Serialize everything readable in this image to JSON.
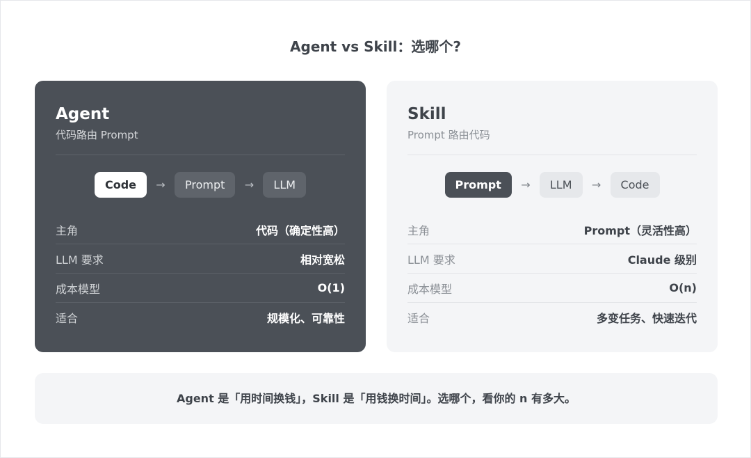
{
  "title": "Agent vs Skill：选哪个?",
  "cards": [
    {
      "title": "Agent",
      "subtitle": "代码路由 Prompt",
      "flow": [
        "Code",
        "Prompt",
        "LLM"
      ],
      "arrow": "→",
      "rows": [
        {
          "label": "主角",
          "value": "代码（确定性高）"
        },
        {
          "label": "LLM 要求",
          "value": "相对宽松"
        },
        {
          "label": "成本模型",
          "value": "O(1)"
        },
        {
          "label": "适合",
          "value": "规模化、可靠性"
        }
      ]
    },
    {
      "title": "Skill",
      "subtitle": "Prompt 路由代码",
      "flow": [
        "Prompt",
        "LLM",
        "Code"
      ],
      "arrow": "→",
      "rows": [
        {
          "label": "主角",
          "value": "Prompt（灵活性高）"
        },
        {
          "label": "LLM 要求",
          "value": "Claude 级别"
        },
        {
          "label": "成本模型",
          "value": "O(n)"
        },
        {
          "label": "适合",
          "value": "多变任务、快速迭代"
        }
      ]
    }
  ],
  "footer": "Agent 是「用时间换钱」，Skill 是「用钱换时间」。选哪个，看你的 n 有多大。"
}
